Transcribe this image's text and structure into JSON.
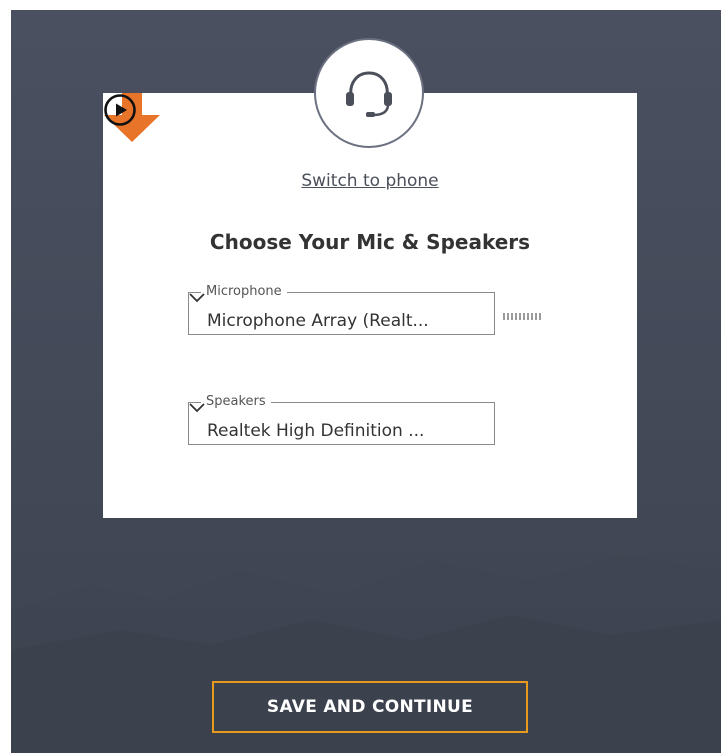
{
  "dialog": {
    "switch_link": "Switch to phone",
    "title": "Choose Your Mic & Speakers"
  },
  "microphone": {
    "legend": "Microphone",
    "selected": "Microphone Array (Realt..."
  },
  "speakers": {
    "legend": "Speakers",
    "selected": "Realtek High Definition ..."
  },
  "footer": {
    "save_label": "SAVE AND CONTINUE"
  },
  "icons": {
    "headset": "headset-icon",
    "dropdown": "chevron-down-icon",
    "play": "play-icon",
    "arrow": "arrow-down-icon",
    "level_meter": "mic-level-meter"
  },
  "colors": {
    "background": "#444a58",
    "card": "#ffffff",
    "accent_border": "#e89a1e",
    "arrow": "#e8742a"
  }
}
